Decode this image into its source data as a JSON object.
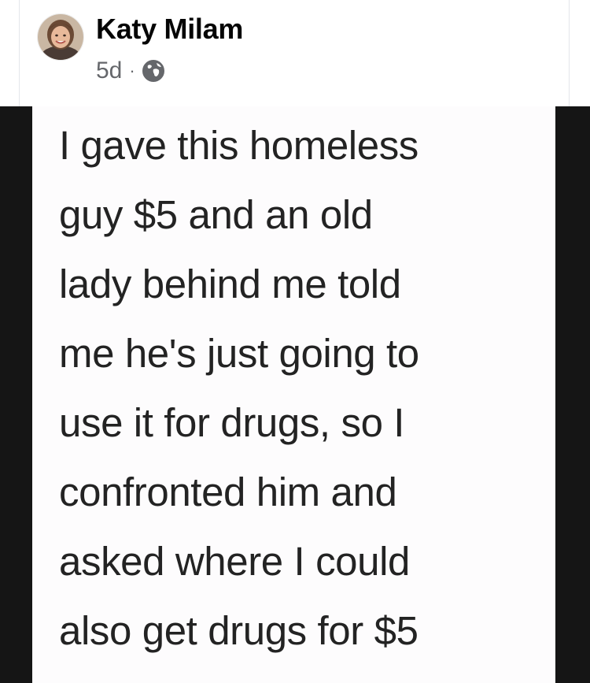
{
  "post": {
    "author": "Katy Milam",
    "timestamp": "5d",
    "separator": "·",
    "audience_icon": "globe-icon"
  },
  "meme": {
    "lines": [
      "I gave this homeless",
      "guy $5 and an old",
      "lady behind me told",
      "me he's just going to",
      "use it for drugs, so I",
      "confronted him and",
      "asked where I could",
      "also get drugs for $5"
    ]
  },
  "colors": {
    "author_text": "#050505",
    "meta_text": "#65676b",
    "meme_background": "#fdfcfd",
    "meme_text": "#232323",
    "letterbox": "#151515"
  }
}
